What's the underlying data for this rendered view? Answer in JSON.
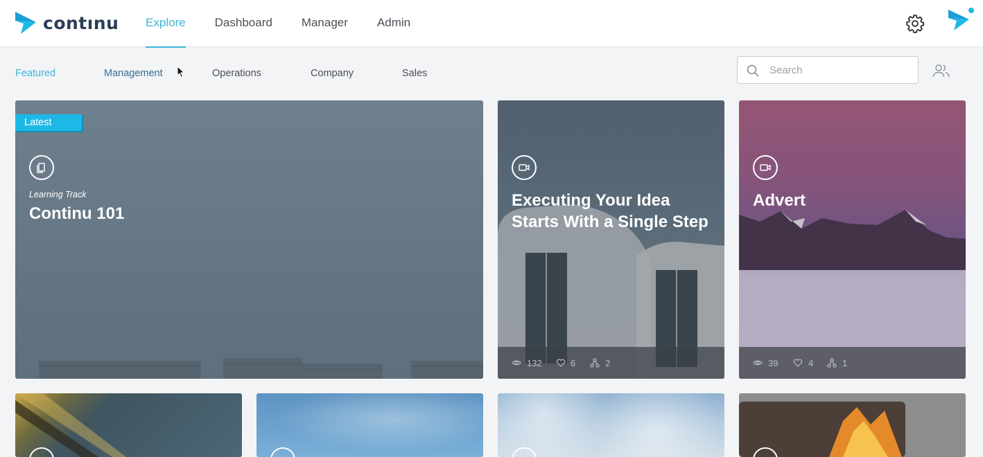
{
  "app": {
    "logo_text": "contınu"
  },
  "nav": {
    "items": [
      "Explore",
      "Dashboard",
      "Manager",
      "Admin"
    ],
    "active": "Explore"
  },
  "categories": {
    "items": [
      "Featured",
      "Management",
      "Operations",
      "Company",
      "Sales"
    ],
    "active": "Featured"
  },
  "search": {
    "placeholder": "Search",
    "value": ""
  },
  "badge": {
    "label": "Latest"
  },
  "featured_cards": [
    {
      "subtitle": "Learning Track",
      "title": "Continu 101",
      "type": "track-icon"
    },
    {
      "title": "Executing Your Idea Starts With a Single Step",
      "type": "video-icon",
      "views": "132",
      "likes": "6",
      "shares": "2"
    },
    {
      "title": "Advert",
      "type": "video-icon",
      "views": "39",
      "likes": "4",
      "shares": "1"
    }
  ],
  "colors": {
    "accent": "#3fb3d8",
    "badge": "#1eb8e6",
    "logo_dark": "#2b3d57"
  }
}
